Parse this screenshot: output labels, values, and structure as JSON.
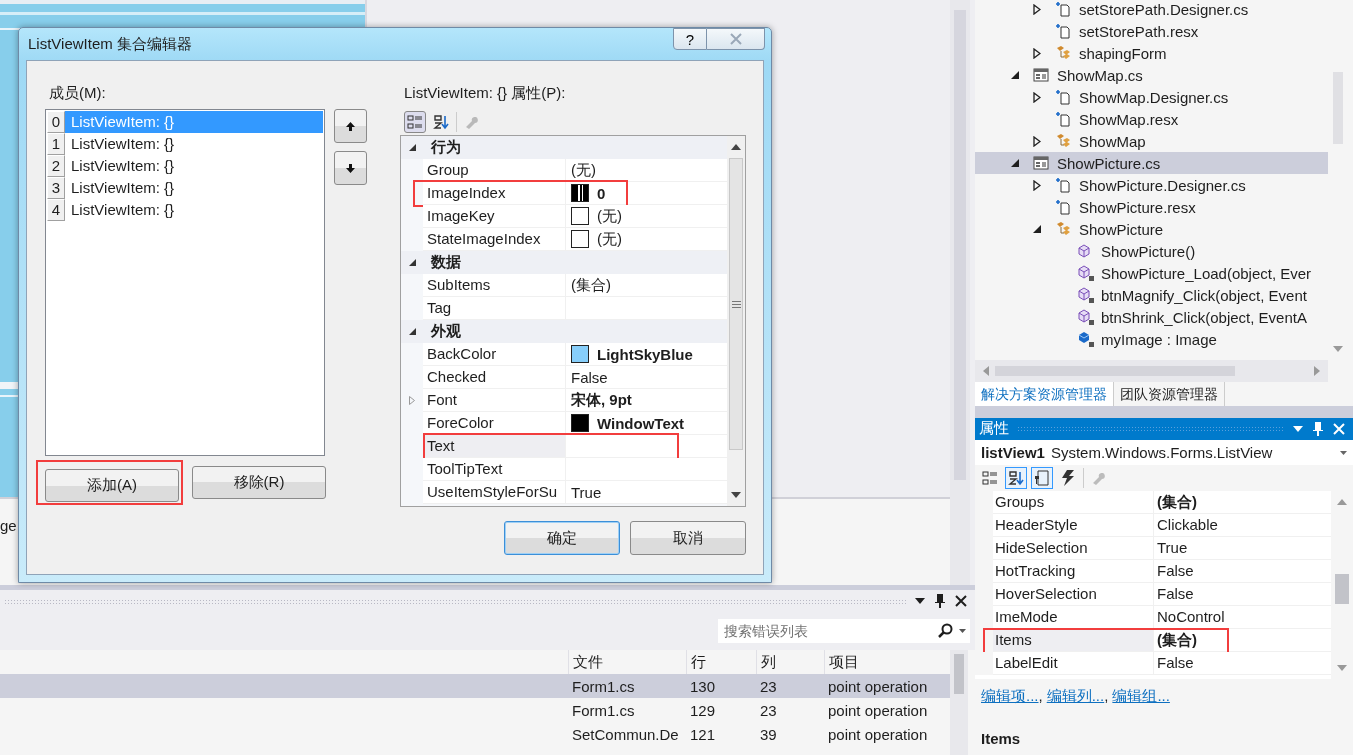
{
  "designer": {
    "caption_fragment": "ge"
  },
  "error_list": {
    "search": {
      "placeholder": "搜索错误列表"
    },
    "columns": [
      "文件",
      "行",
      "列",
      "项目"
    ],
    "rows": [
      {
        "cells": [
          "Form1.cs",
          "130",
          "23",
          "point operation"
        ],
        "selected": true
      },
      {
        "cells": [
          "Form1.cs",
          "129",
          "23",
          "point operation"
        ],
        "selected": false
      },
      {
        "cells": [
          "SetCommun.De",
          "121",
          "39",
          "point operation"
        ],
        "selected": false
      }
    ]
  },
  "solution_explorer": {
    "tree": {
      "partial_children": [
        {
          "label": "setStorePath.Designer.cs",
          "kind": "code_file",
          "expanded": false,
          "selected": false
        },
        {
          "label": "setStorePath.resx",
          "kind": "code_file",
          "selected": false
        },
        {
          "label": "shapingForm",
          "kind": "class",
          "expanded": false,
          "selected": false
        }
      ],
      "items": [
        {
          "label": "ShowMap.cs",
          "kind": "form",
          "expanded": true,
          "selected": false,
          "children": [
            {
              "label": "ShowMap.Designer.cs",
              "kind": "code_file",
              "expanded": false,
              "selected": false
            },
            {
              "label": "ShowMap.resx",
              "kind": "code_file",
              "selected": false
            },
            {
              "label": "ShowMap",
              "kind": "class",
              "expanded": false,
              "selected": false
            }
          ]
        },
        {
          "label": "ShowPicture.cs",
          "kind": "form",
          "expanded": true,
          "selected": true,
          "children": [
            {
              "label": "ShowPicture.Designer.cs",
              "kind": "code_file",
              "expanded": false,
              "selected": false
            },
            {
              "label": "ShowPicture.resx",
              "kind": "code_file",
              "selected": false
            },
            {
              "label": "ShowPicture",
              "kind": "class",
              "expanded": true,
              "selected": false,
              "children": [
                {
                  "label": "ShowPicture()",
                  "kind": "method",
                  "selected": false
                },
                {
                  "label": "ShowPicture_Load(object, Ever",
                  "kind": "private_method",
                  "selected": false
                },
                {
                  "label": "btnMagnify_Click(object, Event",
                  "kind": "private_method",
                  "selected": false
                },
                {
                  "label": "btnShrink_Click(object, EventA",
                  "kind": "private_method",
                  "selected": false
                },
                {
                  "label": "myImage : Image",
                  "kind": "private_field",
                  "selected": false
                }
              ]
            }
          ]
        }
      ]
    },
    "tabs": [
      {
        "label": "解决方案资源管理器",
        "selected": true
      },
      {
        "label": "团队资源管理器",
        "selected": false
      }
    ]
  },
  "properties": {
    "title": "属性",
    "object_name": "listView1",
    "object_type": "System.Windows.Forms.ListView",
    "toolbar": [
      {
        "kind": "categorized",
        "selected": false,
        "disabled": false
      },
      {
        "kind": "alphabetical",
        "selected": true,
        "disabled": false
      },
      {
        "kind": "properties",
        "selected": true,
        "disabled": false
      },
      {
        "kind": "events",
        "selected": false,
        "disabled": false
      },
      {
        "kind": "property_pages",
        "selected": false,
        "disabled": true
      }
    ],
    "rows": [
      {
        "name": "Groups",
        "value": "(集合)",
        "bold": true,
        "selected": false,
        "annotated": false
      },
      {
        "name": "HeaderStyle",
        "value": "Clickable",
        "bold": false,
        "selected": false,
        "annotated": false
      },
      {
        "name": "HideSelection",
        "value": "True",
        "bold": false,
        "selected": false,
        "annotated": false
      },
      {
        "name": "HotTracking",
        "value": "False",
        "bold": false,
        "selected": false,
        "annotated": false
      },
      {
        "name": "HoverSelection",
        "value": "False",
        "bold": false,
        "selected": false,
        "annotated": false
      },
      {
        "name": "ImeMode",
        "value": "NoControl",
        "bold": false,
        "selected": false,
        "annotated": false
      },
      {
        "name": "Items",
        "value": "(集合)",
        "bold": true,
        "selected": true,
        "annotated": true
      },
      {
        "name": "LabelEdit",
        "value": "False",
        "bold": false,
        "selected": false,
        "annotated": false
      }
    ],
    "links": [
      {
        "label": "编辑项...",
        "separator": ","
      },
      {
        "label": "编辑列...",
        "separator": ","
      },
      {
        "label": "编辑组..."
      }
    ],
    "description_title": "Items"
  },
  "dialog": {
    "title": "ListViewItem 集合编辑器",
    "help_button": "?",
    "members_label": "成员(M):",
    "members": [
      {
        "index": "0",
        "label": "ListViewItem: {}",
        "selected": true
      },
      {
        "index": "1",
        "label": "ListViewItem: {}",
        "selected": false
      },
      {
        "index": "2",
        "label": "ListViewItem: {}",
        "selected": false
      },
      {
        "index": "3",
        "label": "ListViewItem: {}",
        "selected": false
      },
      {
        "index": "4",
        "label": "ListViewItem: {}",
        "selected": false
      }
    ],
    "add_button": {
      "label": "添加(A)",
      "annotated": true
    },
    "remove_button": {
      "label": "移除(R)"
    },
    "properties_label": "ListViewItem: {} 属性(P):",
    "grid_toolbar": [
      {
        "kind": "categorized",
        "selected": true,
        "disabled": false
      },
      {
        "kind": "alphabetical",
        "selected": false,
        "disabled": false
      },
      {
        "kind": "property_pages",
        "selected": false,
        "disabled": true
      }
    ],
    "grid": [
      {
        "kind": "category",
        "label": "行为",
        "expanded": true
      },
      {
        "kind": "property",
        "name": "Group",
        "value": "(无)",
        "bold": false,
        "expandable": false,
        "selected": false,
        "annotated": false
      },
      {
        "kind": "property",
        "name": "ImageIndex",
        "value": "0",
        "bold": true,
        "swatch": {
          "kind": "image"
        },
        "expandable": false,
        "selected": false,
        "annotated": true
      },
      {
        "kind": "property",
        "name": "ImageKey",
        "value": "(无)",
        "bold": false,
        "swatch": {
          "kind": "color",
          "color": "#ffffff"
        },
        "expandable": false,
        "selected": false,
        "annotated": false
      },
      {
        "kind": "property",
        "name": "StateImageIndex",
        "value": "(无)",
        "bold": false,
        "swatch": {
          "kind": "color",
          "color": "#ffffff"
        },
        "expandable": false,
        "selected": false,
        "annotated": false
      },
      {
        "kind": "category",
        "label": "数据",
        "expanded": true
      },
      {
        "kind": "property",
        "name": "SubItems",
        "value": "(集合)",
        "bold": false,
        "expandable": false,
        "selected": false,
        "annotated": false
      },
      {
        "kind": "property",
        "name": "Tag",
        "expandable": false,
        "selected": false,
        "annotated": false
      },
      {
        "kind": "category",
        "label": "外观",
        "expanded": true
      },
      {
        "kind": "property",
        "name": "BackColor",
        "value": "LightSkyBlue",
        "bold": true,
        "swatch": {
          "kind": "color",
          "color": "#87cefa"
        },
        "expandable": false,
        "selected": false,
        "annotated": false
      },
      {
        "kind": "property",
        "name": "Checked",
        "value": "False",
        "bold": false,
        "expandable": false,
        "selected": false,
        "annotated": false
      },
      {
        "kind": "property",
        "name": "Font",
        "value": "宋体, 9pt",
        "bold": true,
        "expandable": true,
        "selected": false,
        "annotated": false
      },
      {
        "kind": "property",
        "name": "ForeColor",
        "value": "WindowText",
        "bold": true,
        "swatch": {
          "kind": "color",
          "color": "#000000"
        },
        "expandable": false,
        "selected": false,
        "annotated": false
      },
      {
        "kind": "property",
        "name": "Text",
        "expandable": false,
        "selected": true,
        "annotated": true
      },
      {
        "kind": "property",
        "name": "ToolTipText",
        "expandable": false,
        "selected": false,
        "annotated": false
      },
      {
        "kind": "property",
        "name": "UseItemStyleForSu",
        "value": "True",
        "bold": false,
        "expandable": false,
        "selected": false,
        "annotated": false
      }
    ],
    "buttons": [
      {
        "label": "确定",
        "default": true
      },
      {
        "label": "取消",
        "default": false
      }
    ]
  }
}
